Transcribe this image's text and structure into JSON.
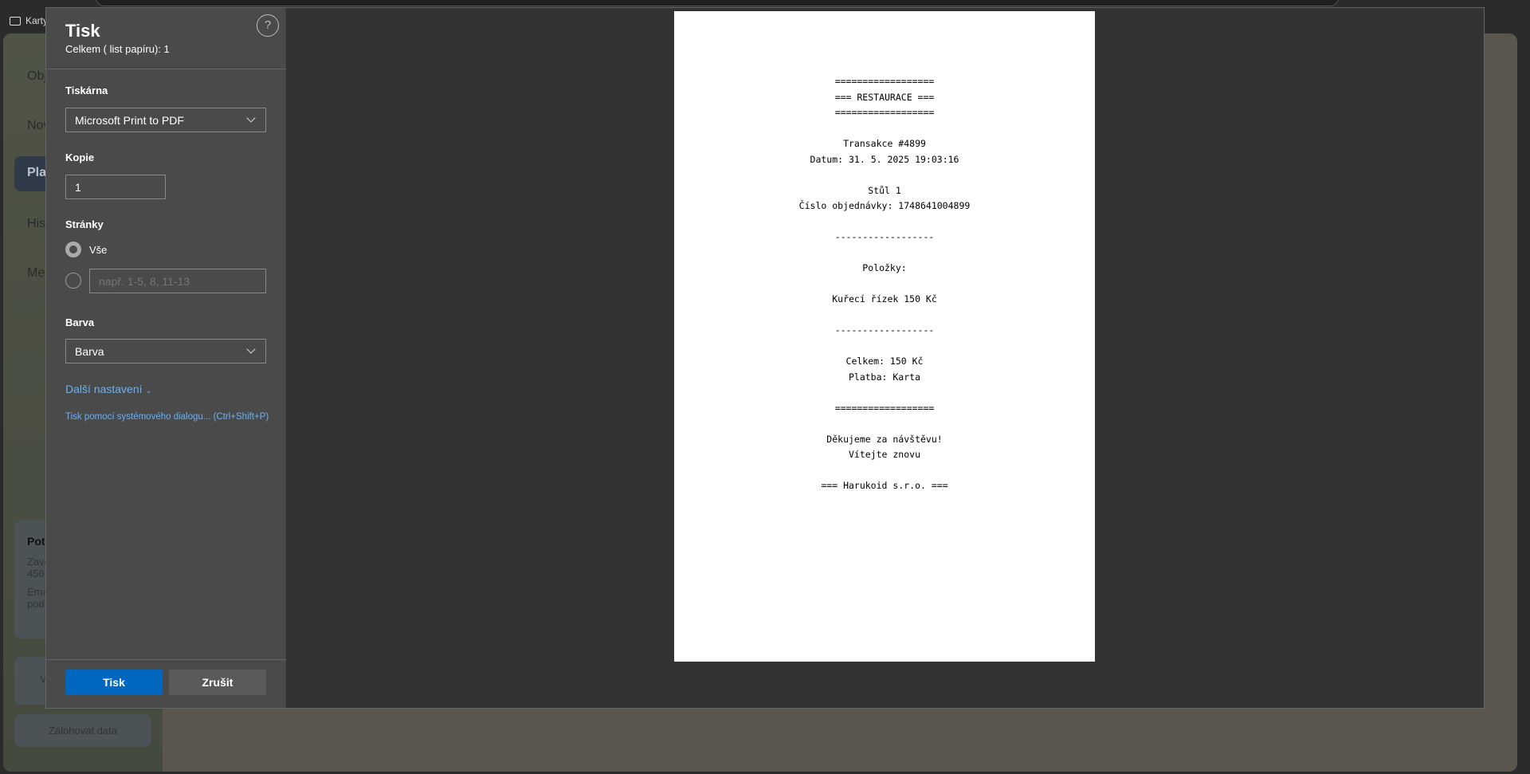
{
  "browser": {
    "bookmark": "Karty"
  },
  "background_app": {
    "nav": [
      "Obj",
      "Nov",
      "Pla",
      "His",
      "Me"
    ],
    "card": {
      "title": "Pot",
      "line1": "Zavo",
      "line2": "456",
      "line3": "Ema",
      "line4": "pod"
    },
    "button_partial": "V",
    "backup_button": "Zálohovat data"
  },
  "print_dialog": {
    "title": "Tisk",
    "subtitle": "Celkem ( list papíru): 1",
    "help": "?",
    "printer_label": "Tiskárna",
    "printer_value": "Microsoft Print to PDF",
    "copies_label": "Kopie",
    "copies_value": "1",
    "pages_label": "Stránky",
    "pages_all": "Vše",
    "pages_custom_placeholder": "např. 1-5, 8, 11-13",
    "color_label": "Barva",
    "color_value": "Barva",
    "more_settings": "Další nastavení",
    "system_dialog": "Tisk pomocí systémového dialogu... (Ctrl+Shift+P)",
    "print_button": "Tisk",
    "cancel_button": "Zrušit",
    "colors": {
      "primary": "#0067c0",
      "cancel": "#5a5a5a",
      "link": "#6ab0f3"
    }
  },
  "receipt": {
    "lines": [
      "==================",
      "=== RESTAURACE ===",
      "==================",
      "",
      "Transakce #4899",
      "Datum: 31. 5. 2025 19:03:16",
      "",
      "Stůl 1",
      "Číslo objednávky: 1748641004899",
      "",
      "------------------",
      "",
      "Položky:",
      "",
      "Kuřecí řízek 150 Kč",
      "",
      "------------------",
      "",
      "Celkem: 150 Kč",
      "Platba: Karta",
      "",
      "==================",
      "",
      "Děkujeme za návštěvu!",
      "Vítejte znovu",
      "",
      "=== Harukoid s.r.o. ==="
    ]
  }
}
